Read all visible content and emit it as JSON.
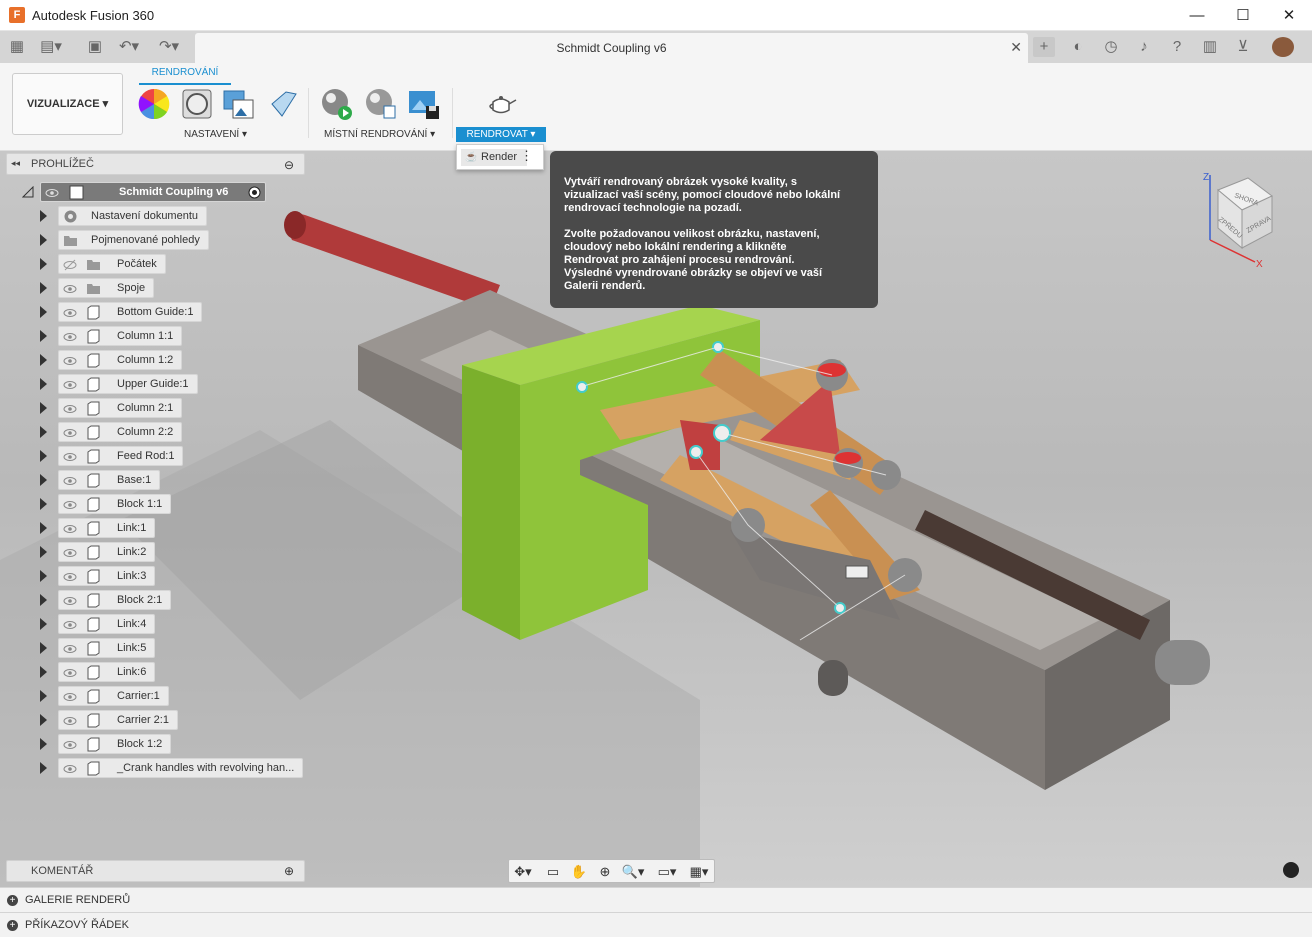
{
  "app": {
    "title": "Autodesk Fusion 360",
    "logo_letter": "F"
  },
  "window_controls": {
    "minimize": "—",
    "maximize": "☐",
    "close": "✕"
  },
  "document_tab": {
    "name": "Schmidt Coupling v6",
    "close": "✕"
  },
  "ribbon": {
    "workspace": "VIZUALIZACE ▾",
    "active_tab": "RENDROVÁNÍ",
    "groups": {
      "settings": "NASTAVENÍ ▾",
      "local_render": "MÍSTNÍ RENDROVÁNÍ ▾",
      "render": "RENDROVAT ▾"
    }
  },
  "render_menu": {
    "item": "Render",
    "more": "⋮"
  },
  "tooltip": {
    "paragraph1": "Vytváří rendrovaný obrázek vysoké kvality, s\nvizualizací vaší scény, pomocí cloudové nebo lokální\nrendrovací technologie na pozadí.",
    "paragraph2": "Zvolte požadovanou velikost obrázku, nastavení,\ncloudový nebo lokální rendering a klikněte\nRendrovat pro zahájení procesu rendrování.\nVýsledné vyrendrované obrázky se objeví ve vaší\nGalerii renderů."
  },
  "browser": {
    "title": "PROHLÍŽEČ",
    "collapse": "◂◂",
    "minus": "⊖",
    "root": "Schmidt Coupling v6",
    "items": [
      {
        "label": "Nastavení dokumentu",
        "kind": "gear",
        "hidden": false
      },
      {
        "label": "Pojmenované pohledy",
        "kind": "folder",
        "hidden": false
      },
      {
        "label": "Počátek",
        "kind": "folder",
        "hidden": true
      },
      {
        "label": "Spoje",
        "kind": "folder",
        "hidden": false
      },
      {
        "label": "Bottom Guide:1",
        "kind": "component",
        "hidden": false
      },
      {
        "label": "Column 1:1",
        "kind": "component",
        "hidden": false
      },
      {
        "label": "Column 1:2",
        "kind": "component",
        "hidden": false
      },
      {
        "label": "Upper Guide:1",
        "kind": "component",
        "hidden": false
      },
      {
        "label": "Column 2:1",
        "kind": "component",
        "hidden": false
      },
      {
        "label": "Column 2:2",
        "kind": "component",
        "hidden": false
      },
      {
        "label": "Feed Rod:1",
        "kind": "component",
        "hidden": false
      },
      {
        "label": "Base:1",
        "kind": "component",
        "hidden": false
      },
      {
        "label": "Block 1:1",
        "kind": "component",
        "hidden": false
      },
      {
        "label": "Link:1",
        "kind": "component",
        "hidden": false
      },
      {
        "label": "Link:2",
        "kind": "component",
        "hidden": false
      },
      {
        "label": "Link:3",
        "kind": "component",
        "hidden": false
      },
      {
        "label": "Block 2:1",
        "kind": "component",
        "hidden": false
      },
      {
        "label": "Link:4",
        "kind": "component",
        "hidden": false
      },
      {
        "label": "Link:5",
        "kind": "component",
        "hidden": false
      },
      {
        "label": "Link:6",
        "kind": "component",
        "hidden": false
      },
      {
        "label": "Carrier:1",
        "kind": "component",
        "hidden": false
      },
      {
        "label": "Carrier 2:1",
        "kind": "component",
        "hidden": false
      },
      {
        "label": "Block 1:2",
        "kind": "component",
        "hidden": false
      },
      {
        "label": "_Crank handles with revolving han...",
        "kind": "component",
        "hidden": false
      }
    ]
  },
  "comments": {
    "title": "KOMENTÁŘ",
    "plus": "⊕"
  },
  "viewcube": {
    "top": "SHORA",
    "front": "ZPŘEDU",
    "right": "ZPRAVA",
    "z": "Z",
    "x": "X"
  },
  "bottom_panels": {
    "gallery": "GALERIE RENDERŮ",
    "command": "PŘÍKAZOVÝ ŘÁDEK",
    "plus": "+"
  },
  "nav_icons": [
    "orbit-icon",
    "look-at-icon",
    "pan-icon",
    "zoom-window-icon",
    "zoom-icon",
    "display-settings-icon",
    "grid-settings-icon"
  ],
  "colors": {
    "accent": "#1a8fd0",
    "green_part": "#8fc43a",
    "red_part": "#b03a3a",
    "tan_link": "#d6a262"
  }
}
